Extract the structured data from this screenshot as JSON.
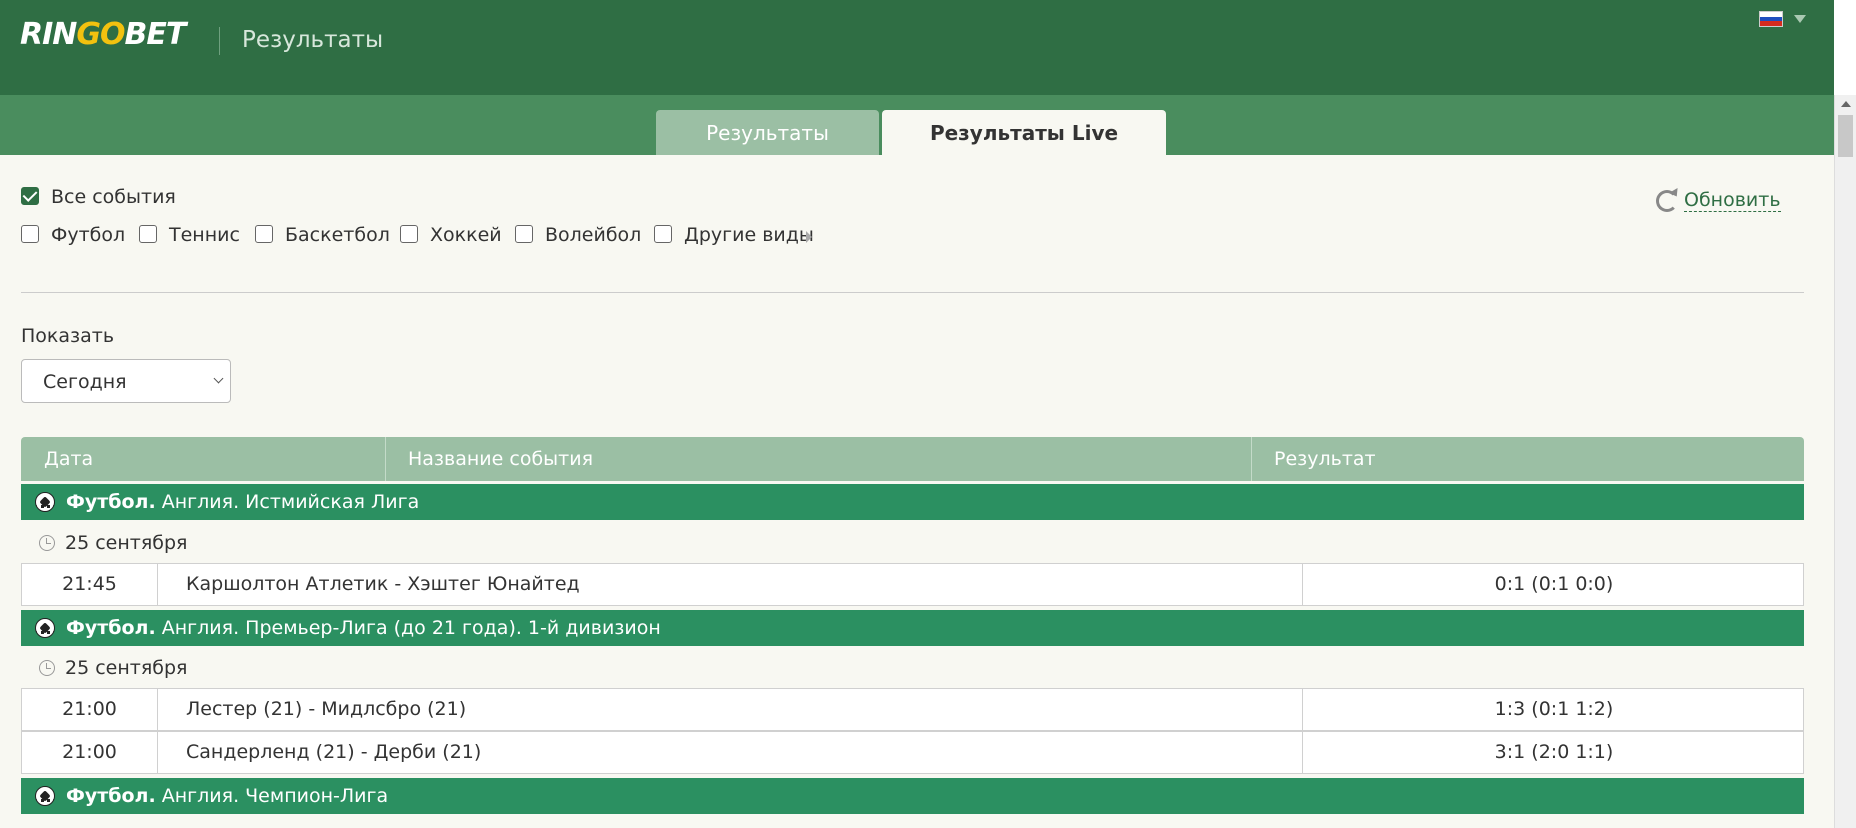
{
  "header": {
    "logo_part1": "RIN",
    "logo_part2": "GO",
    "logo_part3": "BET",
    "title": "Результаты",
    "flag_colors": [
      "#ffffff",
      "#1f4fbf",
      "#d52b1e"
    ]
  },
  "tabs": [
    {
      "label": "Результаты",
      "active": false
    },
    {
      "label": "Результаты Live",
      "active": true
    }
  ],
  "filters": {
    "all_events": {
      "label": "Все события",
      "checked": true
    },
    "sports": [
      {
        "label": "Футбол",
        "checked": false
      },
      {
        "label": "Теннис",
        "checked": false
      },
      {
        "label": "Баскетбол",
        "checked": false
      },
      {
        "label": "Хоккей",
        "checked": false
      },
      {
        "label": "Волейбол",
        "checked": false
      },
      {
        "label": "Другие виды",
        "checked": false
      }
    ]
  },
  "refresh_label": "Обновить",
  "show": {
    "label": "Показать",
    "selected": "Сегодня"
  },
  "table": {
    "headers": [
      "Дата",
      "Название события",
      "Результат"
    ],
    "groups": [
      {
        "sport": "Футбол.",
        "league": "Англия. Истмийская Лига",
        "date": "25 сентября",
        "rows": [
          {
            "time": "21:45",
            "name": "Каршолтон Атлетик - Хэштег Юнайтед",
            "result": "0:1 (0:1 0:0)"
          }
        ]
      },
      {
        "sport": "Футбол.",
        "league": "Англия. Премьер-Лига (до 21 года). 1-й дивизион",
        "date": "25 сентября",
        "rows": [
          {
            "time": "21:00",
            "name": "Лестер (21) - Мидлсбро (21)",
            "result": "1:3 (0:1 1:2)"
          },
          {
            "time": "21:00",
            "name": "Сандерленд (21) - Дерби (21)",
            "result": "3:1 (2:0 1:1)"
          }
        ]
      },
      {
        "sport": "Футбол.",
        "league": "Англия. Чемпион-Лига",
        "rows": []
      }
    ]
  },
  "colors": {
    "header_bg": "#2f6e44",
    "tabbar_bg": "#4a8d5e",
    "group_bg": "#2b9061",
    "table_header_bg": "#9bbfa4",
    "content_bg": "#f8f8f2",
    "logo_accent": "#f2c10f"
  }
}
